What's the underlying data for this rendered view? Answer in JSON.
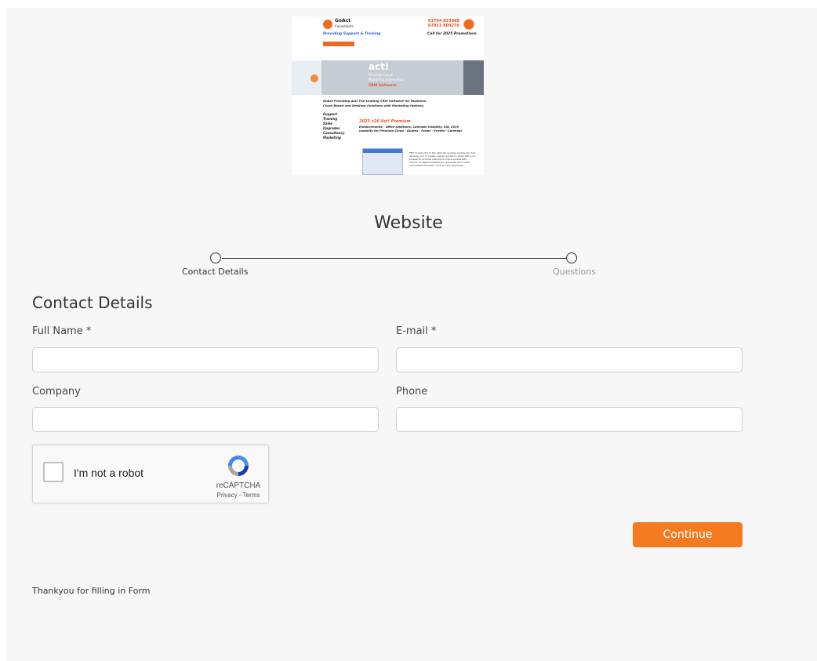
{
  "banner": {
    "logo_name": "GoAct",
    "logo_sub": "Consultants",
    "phone_1": "01704 833988",
    "phone_2": "07831 809270",
    "tagline": "Providing Support & Training",
    "promo": "Call for 2025 Promotions",
    "act_brand": "act!",
    "act_sub_1": "Premium Cloud",
    "act_sub_2": "Marketing Automation",
    "crm": "CRM Software",
    "line_1": "GoAct Providing Act! The Leading CRM Software for Business.",
    "line_2": "Cloud Based and Desktop Solutions with Marketing Options.",
    "services": [
      "Support",
      "Training",
      "Sales",
      "Upgrades",
      "Consultancy",
      "Marketing"
    ],
    "premium_title": "2025 v26 Act! Premium",
    "premium_sub_1": "Enhancements - Office Additions, Calendar Visibility, SQL 2019",
    "premium_sub_2": "Usability for Premium Cloud - Quotes - Forms - Events - Calendar",
    "small_text": "PDF Constructor is the ultimate quoting solution for Act! allowing you to create custom quotes to share with your prospects, provide interactive online quotes with secure, accepted timestamps, generate and collect automated reminders, and process payments."
  },
  "form": {
    "title": "Website",
    "steps": [
      "Contact Details",
      "Questions"
    ],
    "section_title": "Contact Details",
    "fields": {
      "full_name": {
        "label": "Full Name *",
        "value": ""
      },
      "email": {
        "label": "E-mail *",
        "value": ""
      },
      "company": {
        "label": "Company",
        "value": ""
      },
      "phone": {
        "label": "Phone",
        "value": ""
      }
    },
    "captcha": {
      "label": "I'm not a robot",
      "brand": "reCAPTCHA",
      "links": "Privacy - Terms"
    },
    "continue_label": "Continue",
    "footer_note": "Thankyou for filling in Form"
  },
  "colors": {
    "accent": "#f47b20",
    "page_bg": "#f7f7f7"
  }
}
